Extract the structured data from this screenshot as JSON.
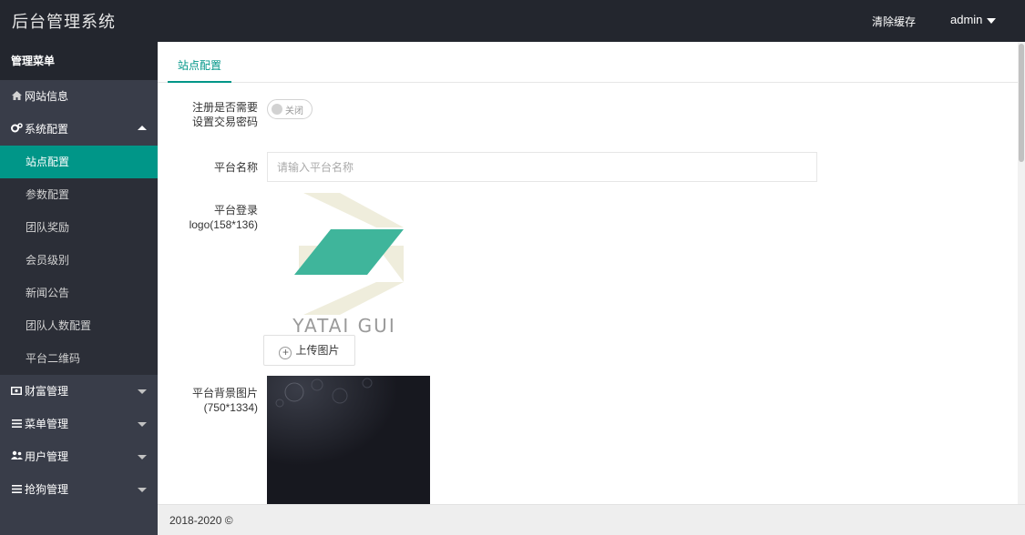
{
  "header": {
    "brand": "后台管理系统",
    "clear_cache": "清除缓存",
    "user": "admin"
  },
  "sidebar": {
    "title": "管理菜单",
    "items": [
      {
        "label": "网站信息",
        "icon": "home-icon"
      },
      {
        "label": "系统配置",
        "icon": "gears-icon",
        "expanded": true
      },
      {
        "label": "站点配置",
        "active": true
      },
      {
        "label": "参数配置"
      },
      {
        "label": "团队奖励"
      },
      {
        "label": "会员级别"
      },
      {
        "label": "新闻公告"
      },
      {
        "label": "团队人数配置"
      },
      {
        "label": "平台二维码"
      },
      {
        "label": "财富管理",
        "icon": "money-icon",
        "expanded": false
      },
      {
        "label": "菜单管理",
        "icon": "list-icon",
        "expanded": false
      },
      {
        "label": "用户管理",
        "icon": "users-icon",
        "expanded": false
      },
      {
        "label": "抢狗管理",
        "icon": "list-icon",
        "expanded": false
      }
    ]
  },
  "main": {
    "tab": "站点配置",
    "form": {
      "trade_password": {
        "label_line1": "注册是否需要",
        "label_line2": "设置交易密码",
        "switch_text": "关闭",
        "on": false
      },
      "platform_name": {
        "label": "平台名称",
        "placeholder": "请输入平台名称",
        "value": ""
      },
      "login_logo": {
        "label_line1": "平台登录",
        "label_line2": "logo(158*136)",
        "logo_text": "YATAI GUI",
        "upload_label": "上传图片"
      },
      "background": {
        "label_line1": "平台背景图片",
        "label_line2": "(750*1334)"
      }
    }
  },
  "footer": {
    "copyright": "2018-2020 ©"
  },
  "colors": {
    "accent": "#009688",
    "header_bg": "#23262e",
    "sidebar_bg": "#393d49",
    "logo_green": "#3fb59b",
    "logo_beige": "#efeddc"
  }
}
